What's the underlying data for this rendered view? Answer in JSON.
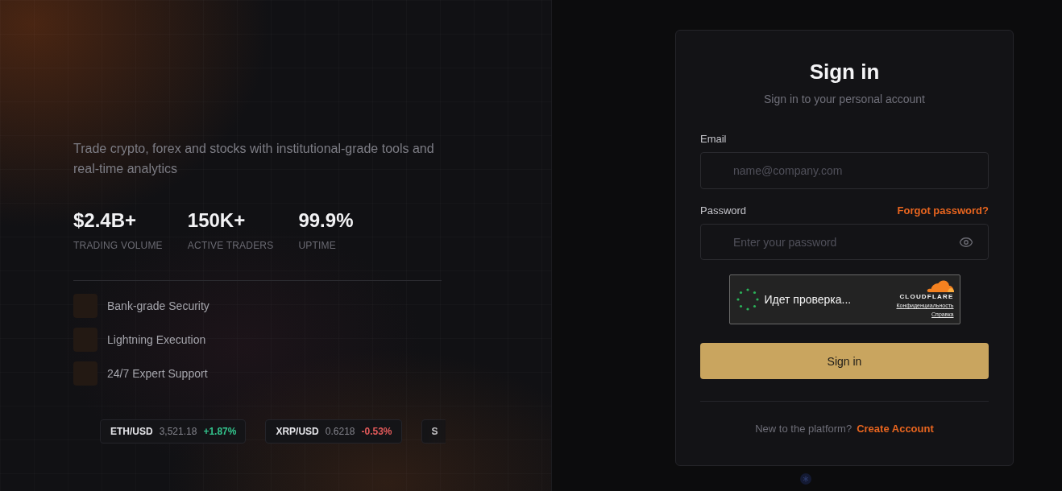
{
  "hero": {
    "tagline": "Trade crypto, forex and stocks with institutional-grade tools and real-time analytics",
    "stats": [
      {
        "value": "$2.4B+",
        "label": "TRADING VOLUME"
      },
      {
        "value": "150K+",
        "label": "ACTIVE TRADERS"
      },
      {
        "value": "99.9%",
        "label": "UPTIME"
      }
    ],
    "features": [
      {
        "label": "Bank-grade Security"
      },
      {
        "label": "Lightning Execution"
      },
      {
        "label": "24/7 Expert Support"
      }
    ],
    "ticker": [
      {
        "pair": "ETH/USD",
        "price": "3,521.18",
        "change": "+1.87%",
        "kind": "gain"
      },
      {
        "pair": "XRP/USD",
        "price": "0.6218",
        "change": "-0.53%",
        "kind": "loss"
      },
      {
        "pair": "S"
      }
    ]
  },
  "signin": {
    "title": "Sign in",
    "subtitle": "Sign in to your personal account",
    "email": {
      "label": "Email",
      "placeholder": "name@company.com"
    },
    "password": {
      "label": "Password",
      "placeholder": "Enter your password",
      "forgot_link": "Forgot password?"
    },
    "captcha": {
      "status": "Идет проверка...",
      "brand": "CLOUDFLARE",
      "links": [
        "Конфиденциальность",
        "Справка"
      ]
    },
    "submit": "Sign in",
    "footer": {
      "prompt": "New to the platform?",
      "link": "Create Account"
    }
  }
}
